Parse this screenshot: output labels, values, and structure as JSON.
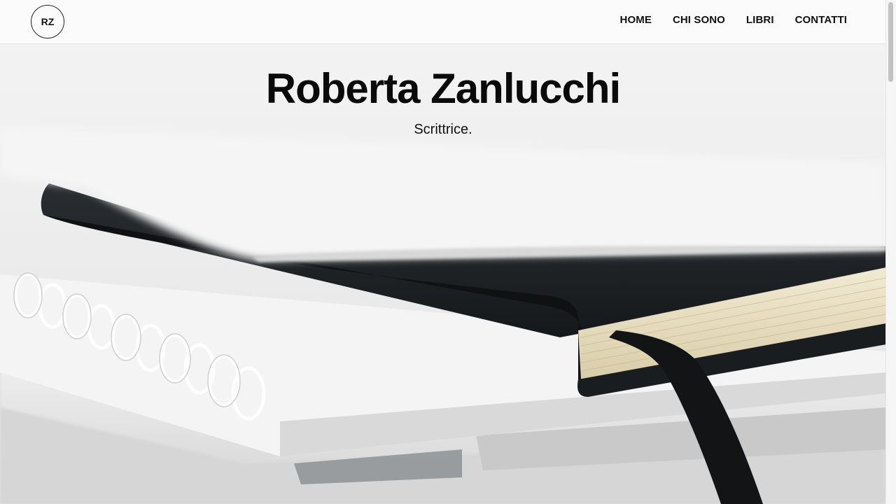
{
  "header": {
    "logo_text": "RZ",
    "nav": [
      {
        "label": "HOME"
      },
      {
        "label": "CHI SONO"
      },
      {
        "label": "LIBRI"
      },
      {
        "label": "CONTATTI"
      }
    ]
  },
  "hero": {
    "title": "Roberta Zanlucchi",
    "subtitle": "Scrittrice.",
    "background_image": "stack-of-notebooks-photo"
  },
  "colors": {
    "header_bg": "#fbfbfb",
    "text": "#111111",
    "notebook_cover": "#1c1f22",
    "page_edges": "#e8dfc6"
  }
}
